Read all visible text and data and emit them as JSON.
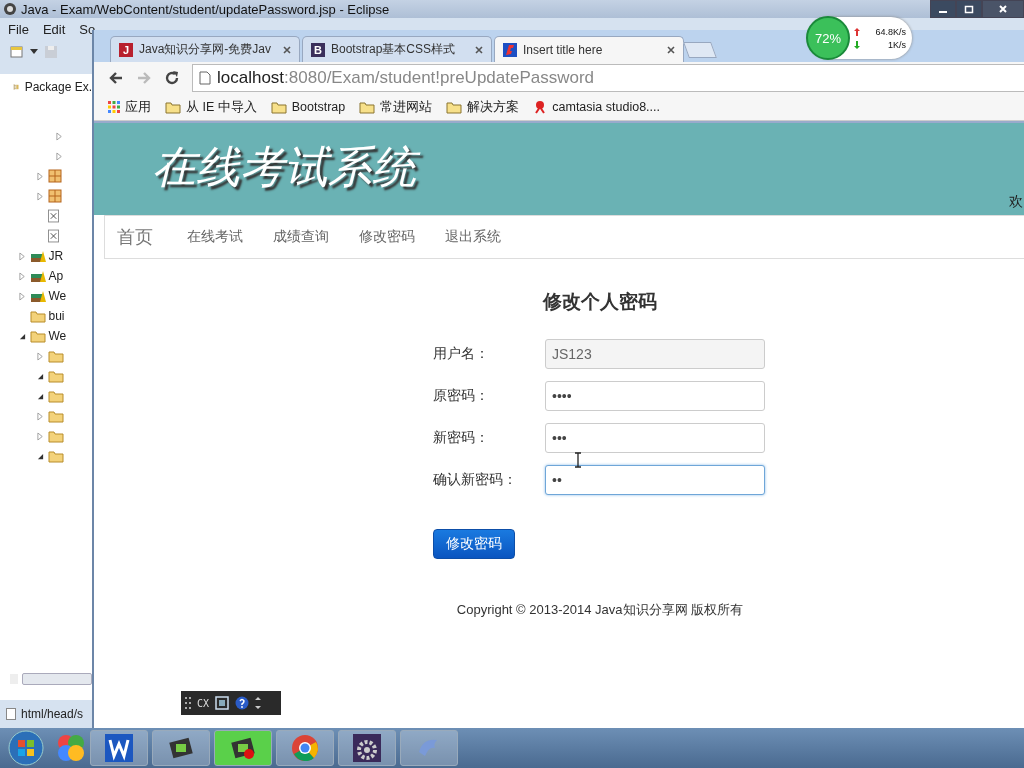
{
  "eclipse": {
    "title": "Java - Exam/WebContent/student/updatePassword.jsp - Eclipse",
    "menu": [
      "File",
      "Edit",
      "So"
    ],
    "view_tab": "Package Ex.",
    "tree": [
      {
        "kind": "group",
        "children": [
          {
            "kind": "group",
            "children": [
              {
                "expanded": false
              },
              {
                "expanded": false
              }
            ]
          },
          {
            "kind": "package",
            "expanded": false
          },
          {
            "kind": "package",
            "expanded": false
          },
          {
            "kind": "file"
          },
          {
            "kind": "file"
          }
        ]
      },
      {
        "kind": "library",
        "label": "JR",
        "expanded": false
      },
      {
        "kind": "library",
        "label": "Ap",
        "expanded": false
      },
      {
        "kind": "library",
        "label": "We",
        "expanded": false
      },
      {
        "kind": "folder",
        "label": "bui"
      },
      {
        "kind": "folder",
        "label": "We",
        "expanded": true,
        "children": [
          {
            "kind": "folder",
            "expanded": false
          },
          {
            "kind": "folder",
            "expanded": true
          },
          {
            "kind": "folder",
            "expanded": true
          },
          {
            "kind": "folder",
            "expanded": false
          },
          {
            "kind": "folder",
            "expanded": false
          },
          {
            "kind": "folder",
            "expanded": true
          }
        ]
      }
    ],
    "status": "html/head/s"
  },
  "browser": {
    "tabs": [
      {
        "title": "Java知识分享网-免费Jav",
        "icon_letter": "J",
        "color": "#b8202e",
        "selected": false
      },
      {
        "title": "Bootstrap基本CSS样式",
        "icon_letter": "B",
        "color": "#3a2f5b",
        "selected": false
      },
      {
        "title": "Insert title here",
        "color": "#1d4fc4",
        "selected": true
      }
    ],
    "address": {
      "host": "localhost",
      "path": ":8080/Exam/student!preUpdatePassword"
    },
    "bookmarks": [
      {
        "kind": "apps",
        "label": "应用"
      },
      {
        "kind": "folder",
        "label": "从 IE 中导入"
      },
      {
        "kind": "folder",
        "label": "Bootstrap"
      },
      {
        "kind": "folder",
        "label": "常进网站"
      },
      {
        "kind": "folder",
        "label": "解决方案"
      },
      {
        "kind": "site",
        "label": "camtasia studio8...."
      }
    ]
  },
  "page": {
    "header_title": "在线考试系统",
    "header_right": "欢",
    "nav": [
      {
        "label": "首页",
        "kind": "brand"
      },
      {
        "label": "在线考试",
        "kind": "link"
      },
      {
        "label": "成绩查询",
        "kind": "link"
      },
      {
        "label": "修改密码",
        "kind": "link"
      },
      {
        "label": "退出系统",
        "kind": "link"
      }
    ],
    "heading": "修改个人密码",
    "fields": [
      {
        "label": "用户名：",
        "value": "JS123",
        "disabled": true,
        "focused": false
      },
      {
        "label": "原密码：",
        "value": "••••",
        "disabled": false,
        "focused": false
      },
      {
        "label": "新密码：",
        "value": "•••",
        "disabled": false,
        "focused": false
      },
      {
        "label": "确认新密码：",
        "value": "••",
        "disabled": false,
        "focused": true
      }
    ],
    "submit": "修改密码",
    "footer": "Copyright © 2013-2014 Java知识分享网 版权所有"
  },
  "net_monitor": {
    "percent": "72%",
    "up": "64.8K/s",
    "down": "1K/s"
  },
  "ime_bar": {
    "label": "CX"
  }
}
